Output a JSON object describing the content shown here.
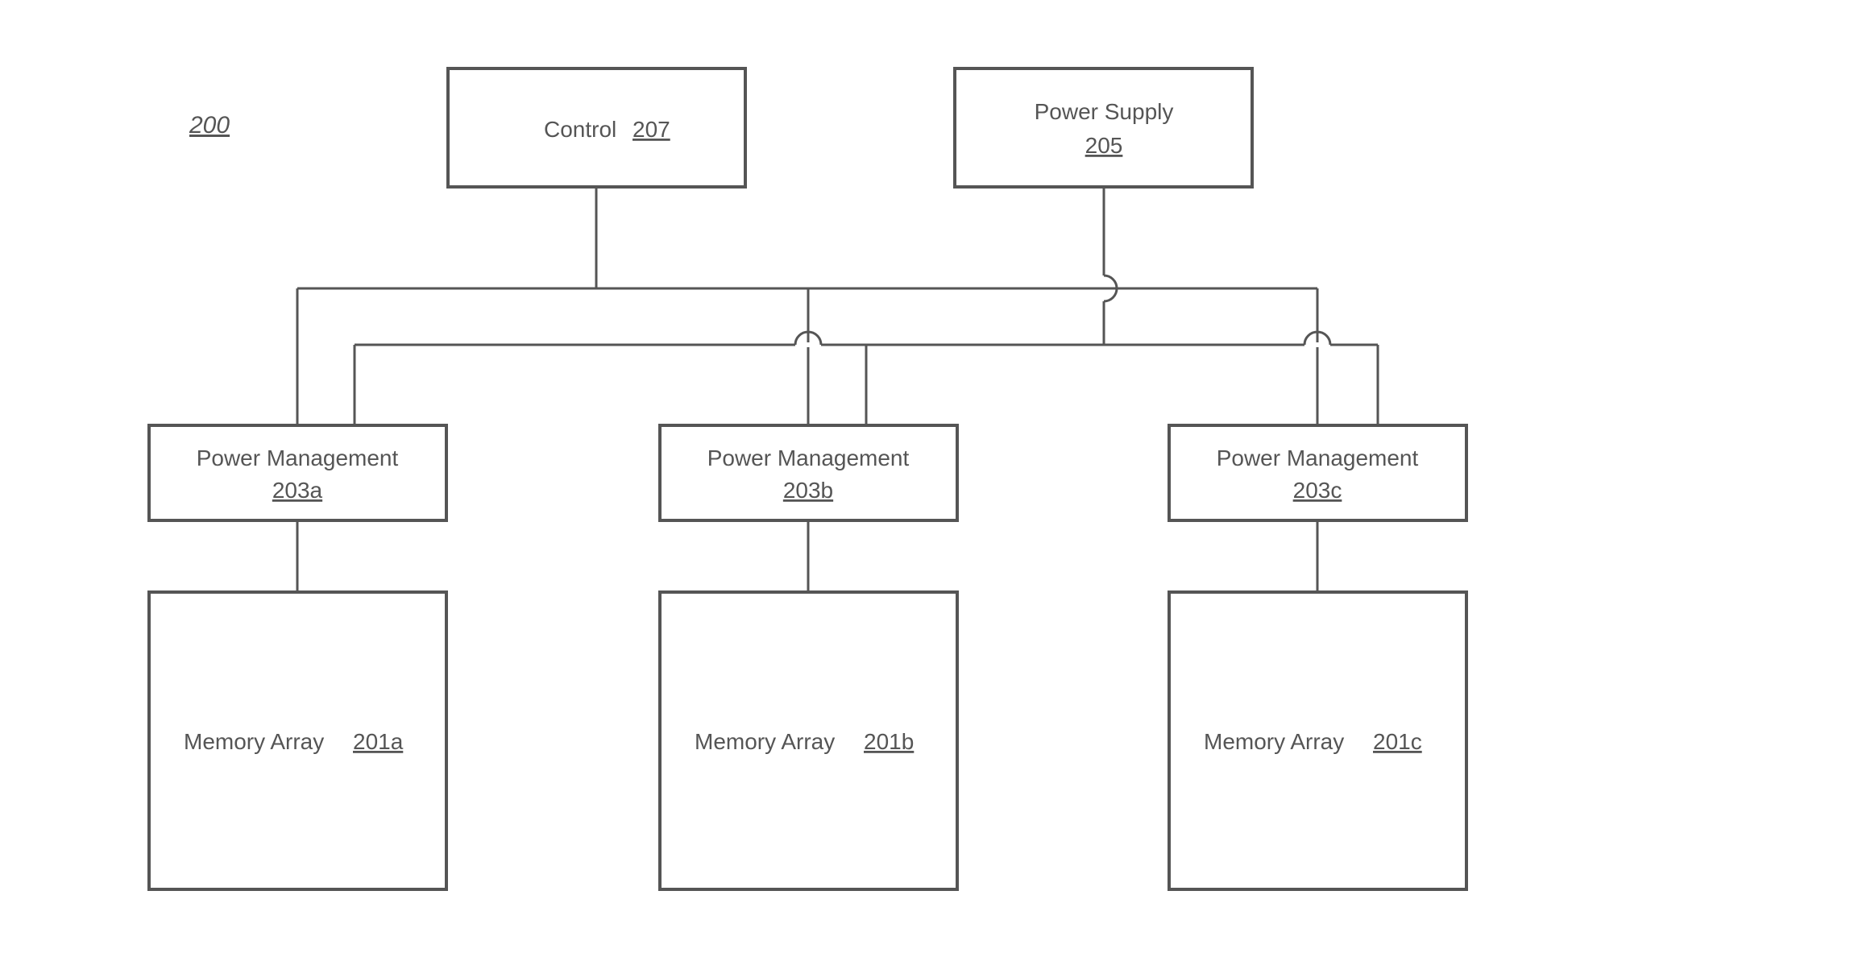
{
  "figure_label": "200",
  "blocks": {
    "control": {
      "label": "Control",
      "ref": "207"
    },
    "power_supply": {
      "label": "Power Supply",
      "ref": "205"
    },
    "pm_a": {
      "label": "Power Management",
      "ref": "203a"
    },
    "pm_b": {
      "label": "Power Management",
      "ref": "203b"
    },
    "pm_c": {
      "label": "Power Management",
      "ref": "203c"
    },
    "mem_a": {
      "label": "Memory Array",
      "ref": "201a"
    },
    "mem_b": {
      "label": "Memory Array",
      "ref": "201b"
    },
    "mem_c": {
      "label": "Memory Array",
      "ref": "201c"
    }
  }
}
